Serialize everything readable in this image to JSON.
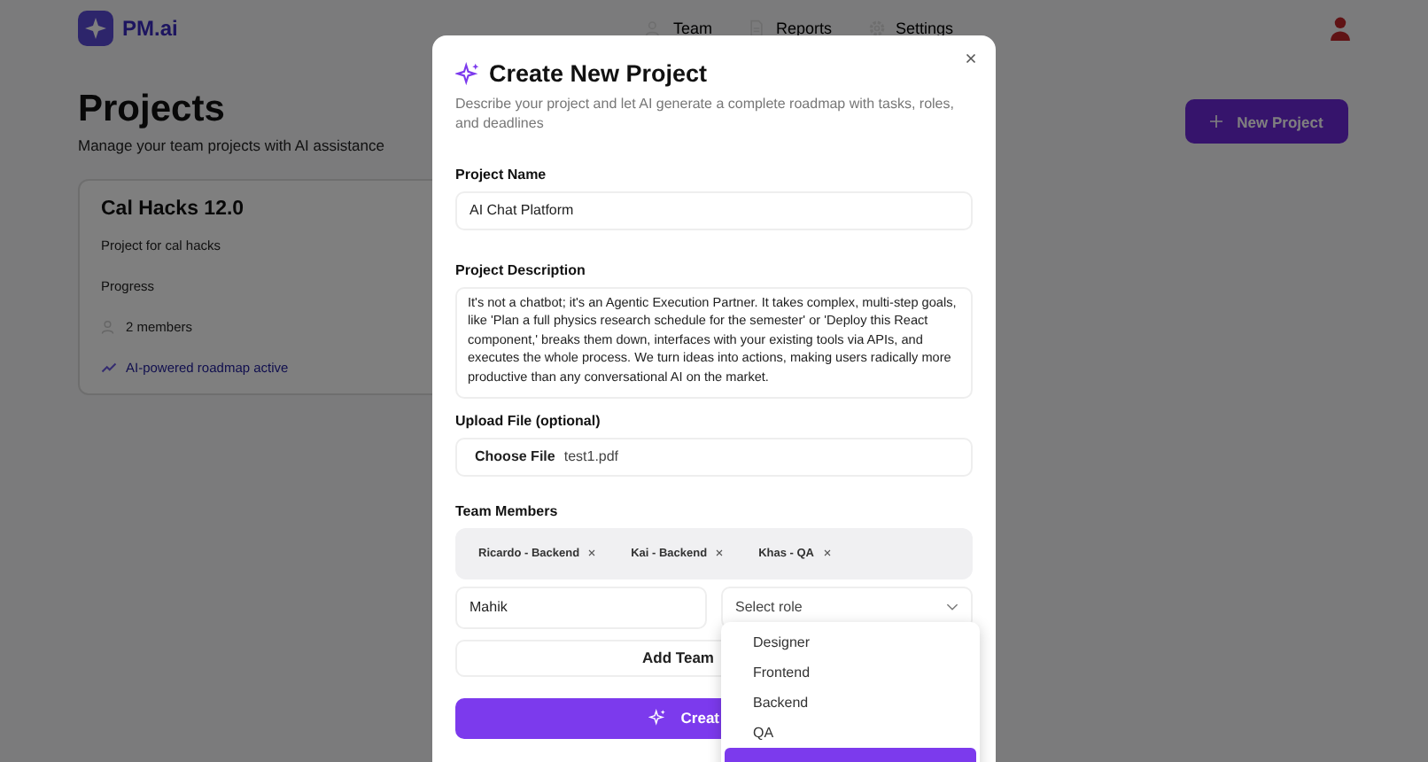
{
  "app": {
    "logo": "PM.ai"
  },
  "nav": [
    {
      "label": "Team",
      "kind": "people"
    },
    {
      "label": "Reports",
      "kind": "document"
    },
    {
      "label": "Settings",
      "kind": "gear"
    }
  ],
  "page": {
    "title": "Projects",
    "subtitle": "Manage your team projects with AI assistance",
    "new_button": "New Project"
  },
  "project_card": {
    "title": "Cal Hacks 12.0",
    "description": "Project for cal hacks",
    "progress_label": "Progress",
    "members": "2 members",
    "status": "AI-powered roadmap active"
  },
  "modal": {
    "title": "Create New Project",
    "description": "Describe your project and let AI generate a complete roadmap with tasks, roles, and deadlines",
    "name_label": "Project Name",
    "name_value": "AI Chat Platform",
    "description_label": "Project Description",
    "description_value": "It's not a chatbot; it's an Agentic Execution Partner. It takes complex, multi-step goals, like 'Plan a full physics research schedule for the semester' or 'Deploy this React component,' breaks them down, interfaces with your existing tools via APIs, and executes the whole process. We turn ideas into actions, making users radically more productive than any conversational AI on the market.",
    "upload_label": "Upload File (optional)",
    "choose_button": "Choose File",
    "file_name": "test1.pdf",
    "team_label": "Team Members",
    "members": [
      {
        "name": "Ricardo - Backend"
      },
      {
        "name": "Kai - Backend"
      },
      {
        "name": "Khas - QA"
      }
    ],
    "member_name_value": "Mahik",
    "role_placeholder": "Select role",
    "add_button": "Add Team",
    "create_button": "Creat",
    "role_options": [
      {
        "label": "Designer",
        "selected": false
      },
      {
        "label": "Frontend",
        "selected": false
      },
      {
        "label": "Backend",
        "selected": false
      },
      {
        "label": "QA",
        "selected": false
      },
      {
        "selected": true
      }
    ]
  }
}
